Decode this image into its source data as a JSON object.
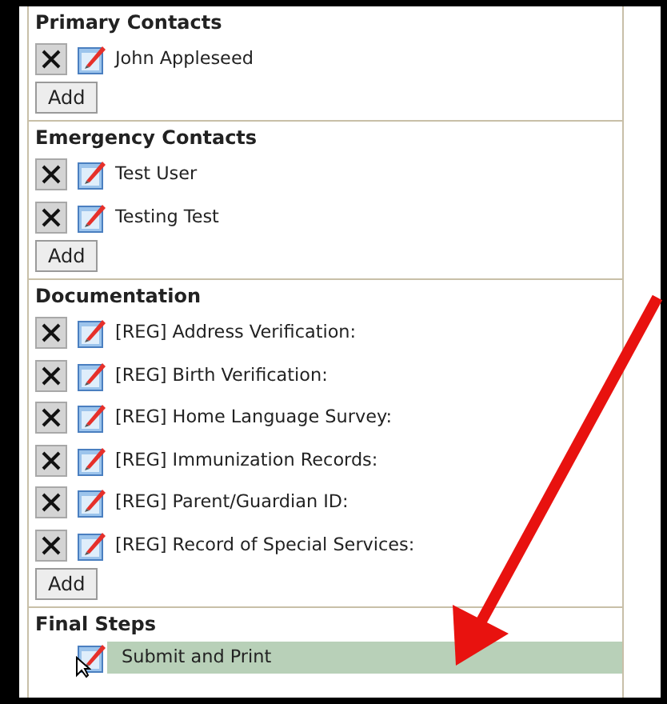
{
  "sections": [
    {
      "title": "Primary Contacts",
      "items": [
        {
          "label": "John Appleseed",
          "removable": true,
          "selected": false
        }
      ],
      "add_button": "Add"
    },
    {
      "title": "Emergency Contacts",
      "items": [
        {
          "label": "Test User",
          "removable": true,
          "selected": false
        },
        {
          "label": "Testing Test",
          "removable": true,
          "selected": false
        }
      ],
      "add_button": "Add"
    },
    {
      "title": "Documentation",
      "items": [
        {
          "label": "[REG] Address Verification:",
          "removable": true,
          "selected": false
        },
        {
          "label": "[REG] Birth Verification:",
          "removable": true,
          "selected": false
        },
        {
          "label": "[REG] Home Language Survey:",
          "removable": true,
          "selected": false
        },
        {
          "label": "[REG] Immunization Records:",
          "removable": true,
          "selected": false
        },
        {
          "label": "[REG] Parent/Guardian ID:",
          "removable": true,
          "selected": false
        },
        {
          "label": "[REG] Record of Special Services:",
          "removable": true,
          "selected": false
        }
      ],
      "add_button": "Add"
    },
    {
      "title": "Final Steps",
      "items": [
        {
          "label": "Submit and Print",
          "removable": false,
          "selected": true
        }
      ]
    }
  ]
}
